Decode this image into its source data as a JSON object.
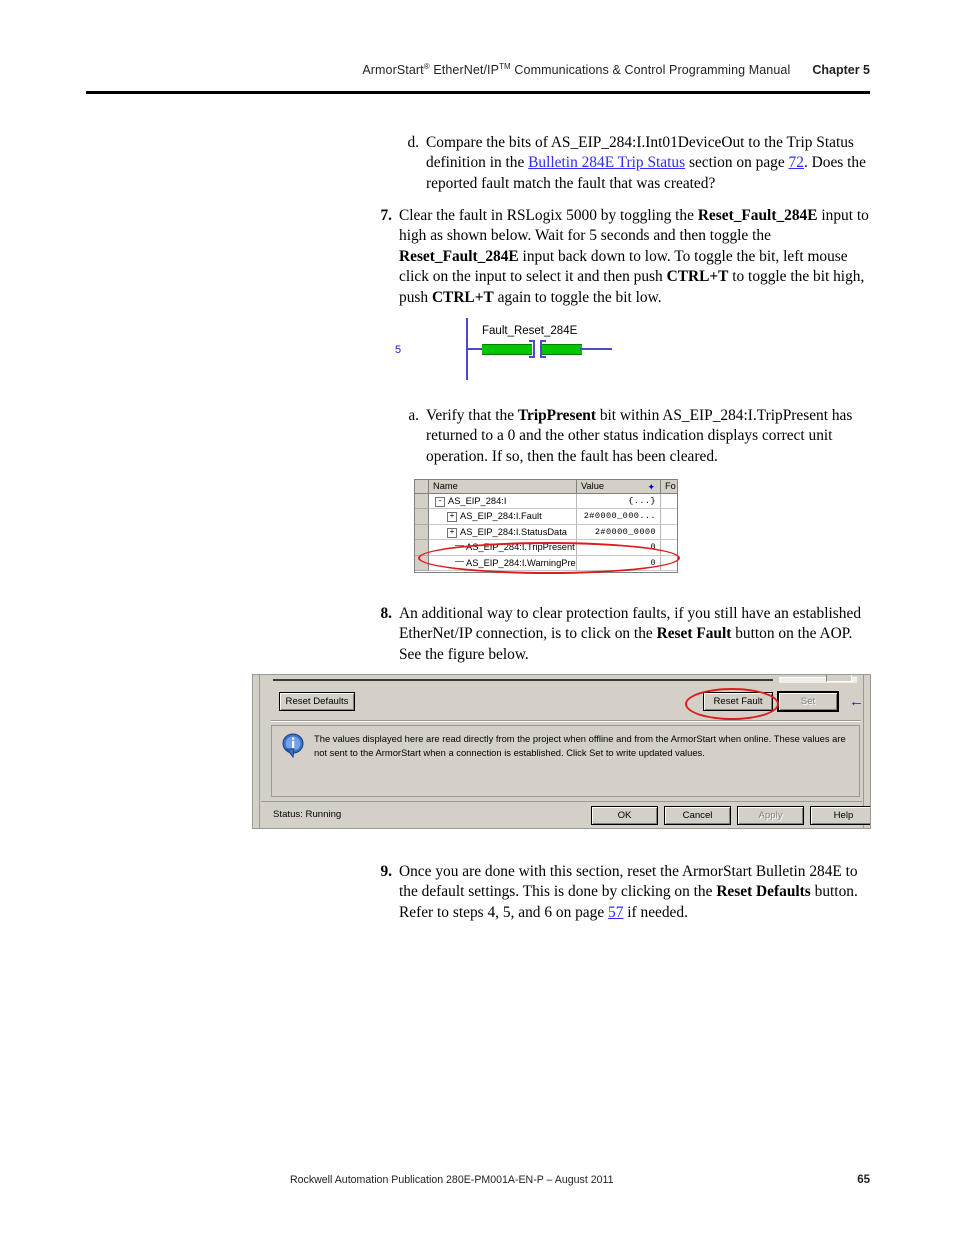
{
  "header": {
    "title_prefix": "ArmorStart",
    "title_sup1": "®",
    "title_mid": " EtherNet/IP",
    "title_sup2": "TM",
    "title_suffix": " Communications & Control Programming Manual",
    "chapter": "Chapter 5"
  },
  "steps": {
    "d": {
      "marker": "d.",
      "text_1": "Compare the bits of AS_EIP_284:I.Int01DeviceOut to the Trip Status definition in the ",
      "link_1": "Bulletin 284E Trip Status",
      "text_2": " section on page ",
      "link_2": "72",
      "text_3": ". Does the reported fault match the fault that was created?"
    },
    "s7": {
      "marker": "7.",
      "t1": "Clear the fault in RSLogix 5000 by toggling the ",
      "b1": "Reset_Fault_284E",
      "t2": " input to high as shown below. Wait for 5 seconds and then toggle the ",
      "b2": "Reset_Fault_284E",
      "t3": " input back down to low. To toggle the bit, left mouse click on the input to select it and then push ",
      "b3": "CTRL+T",
      "t4": " to toggle the bit high, push ",
      "b4": "CTRL+T",
      "t5": " again to toggle the bit low."
    },
    "a": {
      "marker": "a.",
      "t1": "Verify that the ",
      "b1": "TripPresent",
      "t2": " bit within AS_EIP_284:I.TripPresent has returned to a 0 and the other status indication displays correct unit operation. If so, then the fault has been cleared."
    },
    "s8": {
      "marker": "8.",
      "t1": "An additional way to clear protection faults, if you still have an established EtherNet/IP connection, is to click on the ",
      "b1": "Reset Fault",
      "t2": " button on the AOP. See the figure below."
    },
    "s9": {
      "marker": "9.",
      "t1": "Once you are done with this section, reset the ArmorStart Bulletin 284E to the default settings. This is done by clicking on the ",
      "b1": "Reset Defaults",
      "t2": " button. Refer to steps 4, 5, and 6 on page ",
      "link_1": "57",
      "t3": " if needed."
    }
  },
  "ladder_figure": {
    "rung_number": "5",
    "tag_label": "Fault_Reset_284E",
    "rail_color": "#4a4aca",
    "energized_color": "#00c400"
  },
  "tag_monitor": {
    "columns": [
      "Name",
      "Value",
      "Fo"
    ],
    "sort_marker": "✦",
    "rows": [
      {
        "expander": "-",
        "indent": 1,
        "name": "AS_EIP_284:I",
        "value": "{...}"
      },
      {
        "expander": "+",
        "indent": 2,
        "name": "AS_EIP_284:I.Fault",
        "value": "2#0000_000..."
      },
      {
        "expander": "+",
        "indent": 2,
        "name": "AS_EIP_284:I.StatusData",
        "value": "2#0000_0000"
      },
      {
        "expander": "",
        "indent": 3,
        "name": "AS_EIP_284:I.TripPresent",
        "value": "0"
      },
      {
        "expander": "",
        "indent": 3,
        "name": "AS_EIP_284:I.WarningPre...",
        "value": "0"
      }
    ],
    "highlight_color": "#e01b1b"
  },
  "aop_dialog": {
    "reset_defaults_label": "Reset Defaults",
    "reset_fault_label": "Reset Fault",
    "set_label": "Set",
    "arrow_glyph": "←",
    "info_icon_letter": "i",
    "info_text": "The values displayed here are read directly from the project when offline and from the ArmorStart when online. These values are not sent to the ArmorStart when a connection is established.  Click Set to write updated values.",
    "status_label": "Status:  Running",
    "ok_label": "OK",
    "cancel_label": "Cancel",
    "apply_label": "Apply",
    "help_label": "Help",
    "highlight_color": "#e01b1b"
  },
  "footer": {
    "publication": "Rockwell Automation Publication 280E-PM001A-EN-P – August 2011",
    "page_number": "65"
  }
}
